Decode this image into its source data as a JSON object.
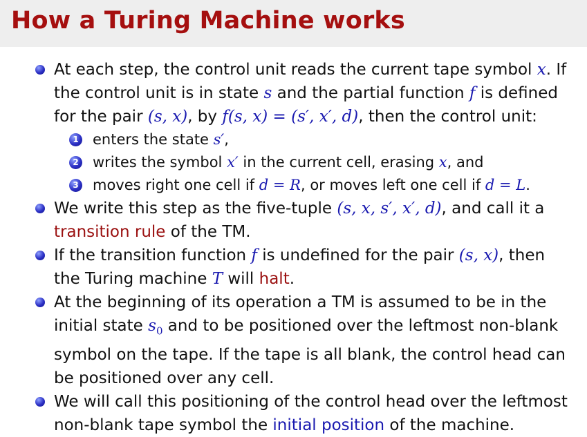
{
  "title": "How a Turing Machine works",
  "bullet1": {
    "l1a": "At each step, the control unit reads the current tape symbol ",
    "l1x": "x",
    "l1b": ". If",
    "l2a": "the control unit is in state ",
    "l2s": "s",
    "l2b": " and the partial function ",
    "l2f": "f",
    "l2c": " is defined",
    "l3a": "for the pair ",
    "l3pair": "(s, x)",
    "l3b": ", by ",
    "l3eq": "f(s, x) = (s′, x′, d)",
    "l3c": ", then the control unit:"
  },
  "sub_items": [
    {
      "num": "1",
      "a": "enters the state ",
      "m1": "s′",
      "b": ",",
      "m2": "",
      "c": "",
      "m3": "",
      "d": ""
    },
    {
      "num": "2",
      "a": "writes the symbol ",
      "m1": "x′",
      "b": " in the current cell, erasing ",
      "m2": "x",
      "c": ", and",
      "m3": "",
      "d": ""
    },
    {
      "num": "3",
      "a": "moves right one cell if ",
      "m1": "d = R",
      "b": ", or moves left one cell if ",
      "m2": "d = L",
      "c": ".",
      "m3": "",
      "d": ""
    }
  ],
  "bullet2": {
    "l1a": "We write this step as the five-tuple ",
    "l1m": "(s, x, s′, x′, d)",
    "l1b": ", and call it a",
    "l2red": "transition rule",
    "l2b": " of the TM."
  },
  "bullet3": {
    "l1a": "If the transition function ",
    "l1f": "f",
    "l1b": " is undefined for the pair ",
    "l1m": "(s, x)",
    "l1c": ", then",
    "l2a": "the Turing machine ",
    "l2T": "T",
    "l2b": " will ",
    "l2red": "halt",
    "l2c": "."
  },
  "bullet4": {
    "l1": "At the beginning of its operation a TM is assumed to be in the",
    "l2a": "initial state ",
    "l2s": "s",
    "l2sub": "0",
    "l2b": " and to be positioned over the leftmost non-blank",
    "l3": "symbol on the tape. If the tape is all blank, the control head can",
    "l4": "be positioned over any cell."
  },
  "bullet5": {
    "l1": "We will call this positioning of the control head over the leftmost",
    "l2a": "non-blank tape symbol the ",
    "l2blue": "initial position",
    "l2b": " of the machine."
  }
}
